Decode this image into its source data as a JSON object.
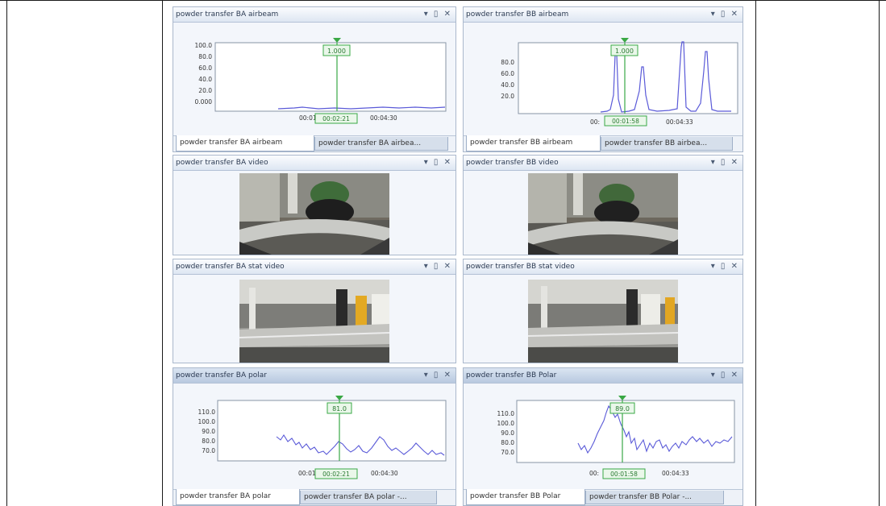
{
  "panels": {
    "ba_airbeam": {
      "title": "powder transfer BA airbeam",
      "tabs": [
        "powder transfer BA airbeam",
        "powder transfer BA airbea..."
      ],
      "cursor_value": "1.000",
      "cursor_time": "00:02:21",
      "x_ticks": [
        "00:01",
        "00:04:30"
      ],
      "y_ticks": [
        "100.0",
        "80.0",
        "60.0",
        "40.0",
        "20.0",
        "0.000"
      ]
    },
    "bb_airbeam": {
      "title": "powder transfer BB airbeam",
      "tabs": [
        "powder transfer BB airbeam",
        "powder transfer BB airbea..."
      ],
      "cursor_value": "1.000",
      "cursor_time": "00:01:58",
      "x_ticks": [
        "00:",
        "00:04:33"
      ],
      "y_ticks": [
        "80.0",
        "60.0",
        "40.0",
        "20.0"
      ]
    },
    "ba_video": {
      "title": "powder transfer BA video"
    },
    "bb_video": {
      "title": "powder transfer BB video"
    },
    "ba_stat_video": {
      "title": "powder transfer BA stat video"
    },
    "bb_stat_video": {
      "title": "powder transfer BB stat video"
    },
    "ba_polar": {
      "title": "powder transfer BA polar",
      "tabs": [
        "powder transfer BA polar",
        "powder transfer BA polar -..."
      ],
      "cursor_value": "81.0",
      "cursor_time": "00:02:21",
      "x_ticks": [
        "00:01",
        "00:04:30"
      ],
      "y_ticks": [
        "110.0",
        "100.0",
        "90.0",
        "80.0",
        "70.0"
      ]
    },
    "bb_polar": {
      "title": "powder transfer BB Polar",
      "tabs": [
        "powder transfer BB Polar",
        "powder transfer BB Polar -..."
      ],
      "cursor_value": "89.0",
      "cursor_time": "00:01:58",
      "x_ticks": [
        "00:",
        "00:04:33"
      ],
      "y_ticks": [
        "110.0",
        "100.0",
        "90.0",
        "80.0",
        "70.0"
      ]
    }
  },
  "icons": {
    "dropdown": "chevron-down-icon",
    "pin": "pin-icon",
    "close": "close-icon"
  },
  "controls": "▾ ▯ ✕",
  "colors": {
    "series": "#5a5ad8",
    "cursor": "#3aa845",
    "cursor_label_bg": "#eaf7ea"
  }
}
